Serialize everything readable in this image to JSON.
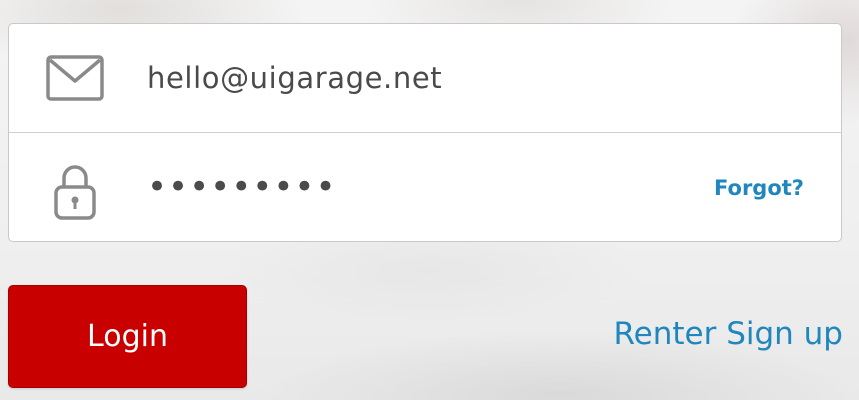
{
  "login_form": {
    "email": {
      "icon": "envelope-icon",
      "value": "hello@uigarage.net"
    },
    "password": {
      "icon": "lock-icon",
      "masked_value": "•••••••••",
      "forgot_label": "Forgot?"
    }
  },
  "actions": {
    "login_label": "Login",
    "signup_label": "Renter Sign up"
  },
  "colors": {
    "primary_button": "#c90000",
    "link": "#1f87bd",
    "icon": "#8a8a8a",
    "text": "#4a4a4a"
  }
}
